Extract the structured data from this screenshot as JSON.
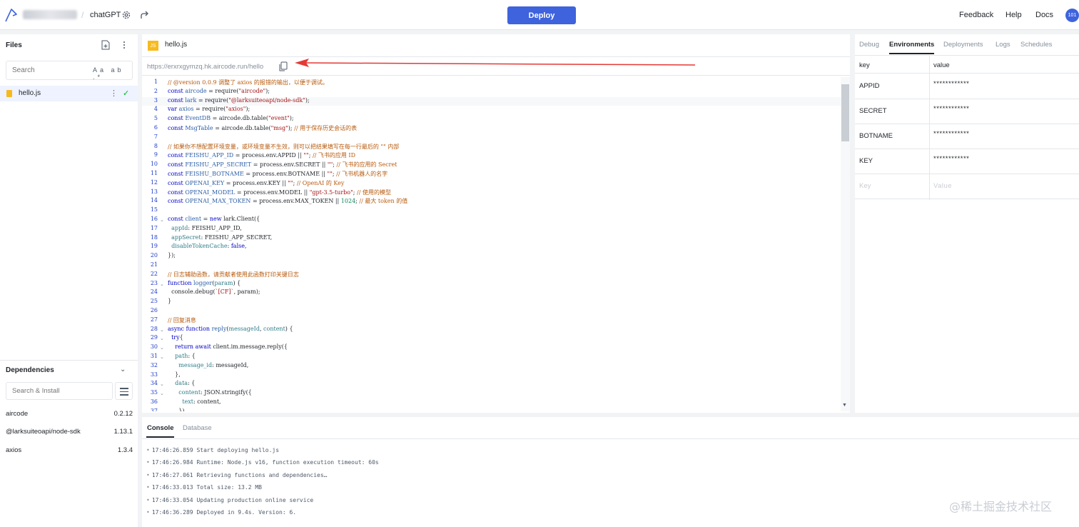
{
  "topbar": {
    "project_name": "chatGPT",
    "deploy_label": "Deploy",
    "links": [
      "Feedback",
      "Help",
      "Docs"
    ],
    "avatar_text": "101"
  },
  "files": {
    "title": "Files",
    "search_placeholder": "Search",
    "search_options": "Aa ab .*",
    "items": [
      {
        "name": "hello.js",
        "status": "✓"
      }
    ]
  },
  "dependencies": {
    "title": "Dependencies",
    "search_placeholder": "Search & Install",
    "items": [
      {
        "name": "aircode",
        "version": "0.2.12"
      },
      {
        "name": "@larksuiteoapi/node-sdk",
        "version": "1.13.1"
      },
      {
        "name": "axios",
        "version": "1.3.4"
      }
    ]
  },
  "editor": {
    "tab_icon": "JS",
    "tab_name": "hello.js",
    "url": "https://erxrxgymzq.hk.aircode.run/hello",
    "foldable_lines": [
      16,
      23,
      28,
      29,
      30,
      31,
      34,
      35
    ]
  },
  "right_panel": {
    "tabs": [
      "Debug",
      "Environments",
      "Deployments",
      "Logs",
      "Schedules"
    ],
    "active_tab": "Environments",
    "headers": {
      "key": "key",
      "value": "value"
    },
    "rows": [
      {
        "key": "APPID",
        "value": "************"
      },
      {
        "key": "SECRET",
        "value": "************"
      },
      {
        "key": "BOTNAME",
        "value": "************"
      },
      {
        "key": "KEY",
        "value": "************"
      }
    ],
    "new_key_placeholder": "Key",
    "new_value_placeholder": "Value"
  },
  "bottom_panel": {
    "tabs": [
      "Console",
      "Database"
    ],
    "active_tab": "Console",
    "logs": [
      "17:46:26.859 Start deploying hello.js",
      "17:46:26.984 Runtime: Node.js v16, function execution timeout: 60s",
      "17:46:27.061 Retrieving functions and dependencies…",
      "17:46:33.013 Total size: 13.2 MB",
      "17:46:33.054 Updating production online service",
      "17:46:36.289 Deployed in 9.4s. Version: 6."
    ]
  },
  "watermark": "@稀土掘金技术社区",
  "colors": {
    "accent": "#3e63dd",
    "success": "#00b42a",
    "annotation_arrow": "#e53935"
  }
}
